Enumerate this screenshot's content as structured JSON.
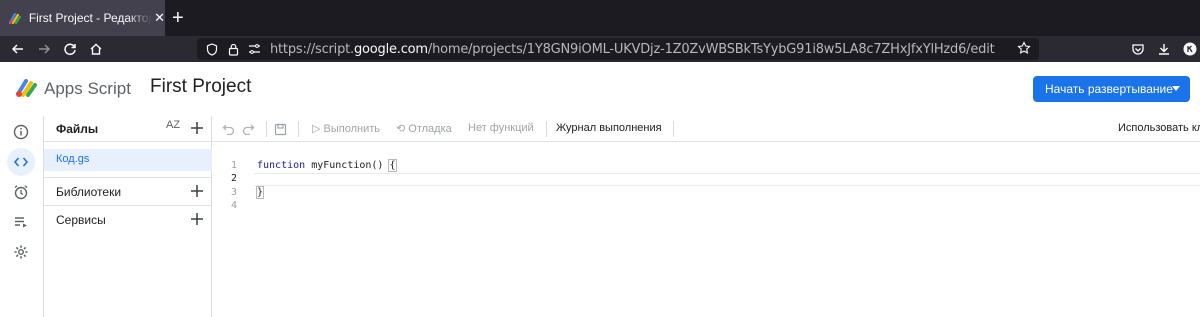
{
  "browser": {
    "tab_title": "First Project - Редактор п",
    "url_prefix": "https://script.",
    "url_domain": "google.com",
    "url_path": "/home/projects/1Y8GN9iOML-UKVDjz-1Z0ZvWBSBkTsYybG91i8w5LA8c7ZHxJfxYlHzd6/edit"
  },
  "header": {
    "app_name": "Apps Script",
    "project_name": "First Project",
    "deploy_label": "Начать развертывание"
  },
  "files_panel": {
    "title": "Файлы",
    "sort_label": "AZ",
    "files": [
      {
        "name": "Код.gs"
      }
    ],
    "sections": [
      {
        "label": "Библиотеки"
      },
      {
        "label": "Сервисы"
      }
    ]
  },
  "toolbar": {
    "run_label": "Выполнить",
    "debug_label": "Отладка",
    "function_label": "Нет функций",
    "log_label": "Журнал выполнения",
    "right_label": "Использовать кл"
  },
  "editor": {
    "line_numbers": [
      "1",
      "2",
      "3",
      "4"
    ],
    "lines": {
      "l1_keyword": "function",
      "l1_rest": " myFunction() ",
      "l1_brace": "{",
      "l3_brace": "}"
    }
  },
  "colors": {
    "accent": "#1a73e8",
    "browser_bg": "#1c1b22",
    "navbar_bg": "#2b2a33"
  }
}
